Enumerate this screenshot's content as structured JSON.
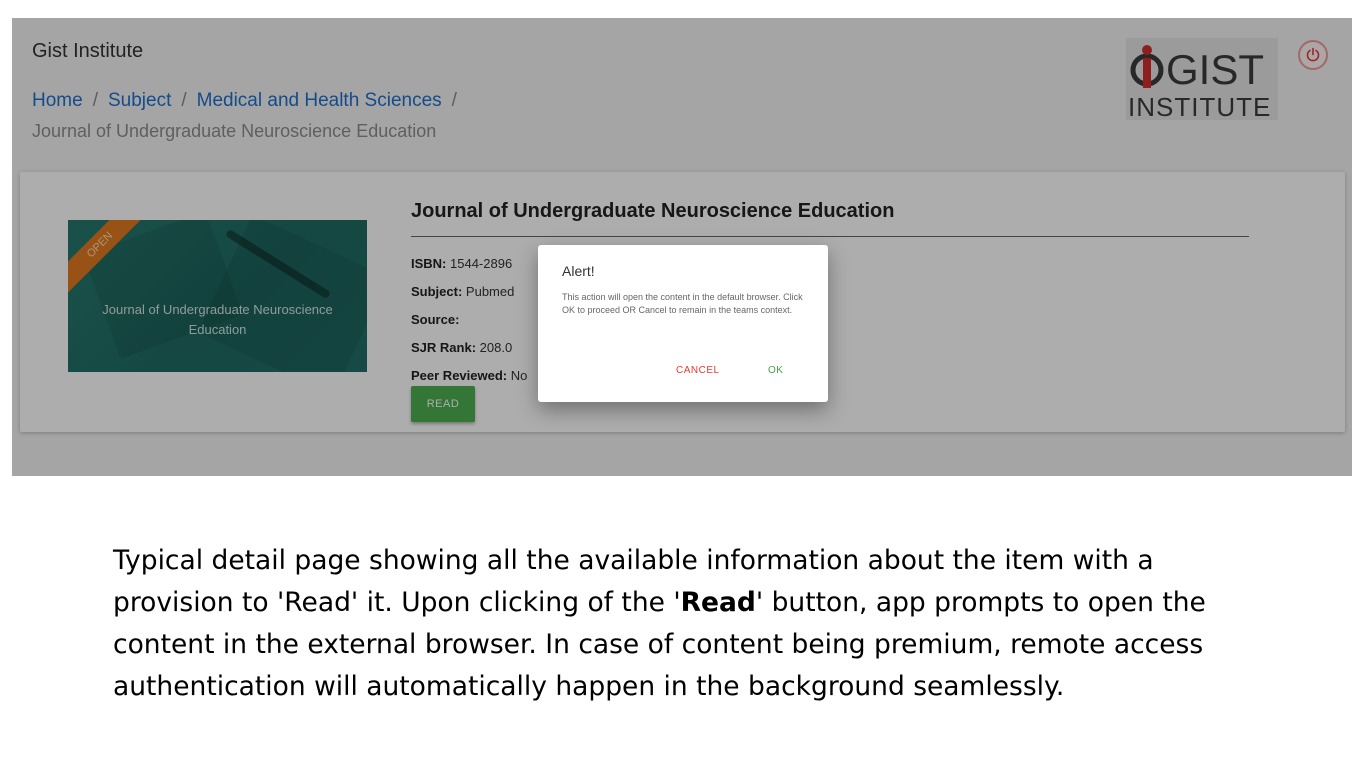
{
  "app": {
    "title": "Gist Institute"
  },
  "breadcrumb": {
    "items": [
      {
        "label": "Home"
      },
      {
        "label": "Subject"
      },
      {
        "label": "Medical and Health Sciences"
      }
    ],
    "separator": "/",
    "current": "Journal of Undergraduate Neuroscience Education"
  },
  "logo": {
    "line1": "GIST",
    "line2": "INSTITUTE",
    "mark_color": "#d32f2f"
  },
  "header": {
    "power_icon": "power-icon"
  },
  "item": {
    "thumbnail_title": "Journal of Undergraduate Neuroscience Education",
    "ribbon_label": "OPEN",
    "title": "Journal of Undergraduate Neuroscience Education",
    "fields": [
      {
        "label": "ISBN:",
        "value": "1544-2896"
      },
      {
        "label": "Subject:",
        "value": "Pubmed"
      },
      {
        "label": "Source:",
        "value": ""
      },
      {
        "label": "SJR Rank:",
        "value": "208.0"
      },
      {
        "label": "Peer Reviewed:",
        "value": "No"
      }
    ],
    "read_label": "READ"
  },
  "dialog": {
    "title": "Alert!",
    "body": "This action will open the content in the default browser. Click OK to proceed OR Cancel to remain in the teams context.",
    "cancel_label": "CANCEL",
    "ok_label": "OK"
  },
  "caption": {
    "part1": "Typical detail page showing all the available information about the item with a provision to 'Read' it. Upon clicking of the '",
    "bold": "Read",
    "part2": "' button, app prompts to open the content in the external browser. In case of content being premium, remote access authentication will automatically happen in the background seamlessly."
  },
  "colors": {
    "link": "#1e6fcf",
    "read_button": "#4caf50",
    "cancel": "#e53935",
    "ok": "#43a047",
    "ribbon": "#e07a1f",
    "thumbnail": "#27786f"
  }
}
